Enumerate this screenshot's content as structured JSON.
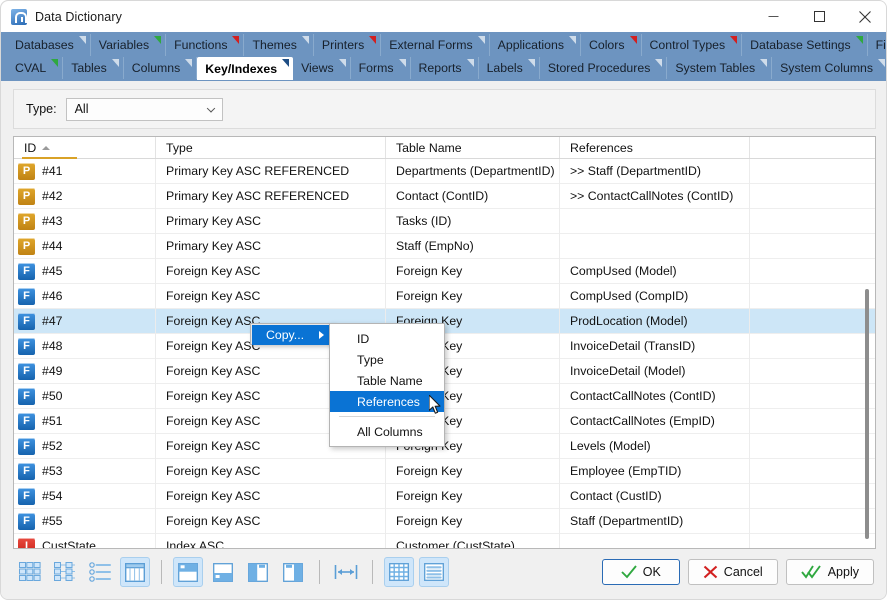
{
  "window": {
    "title": "Data Dictionary",
    "icon": "app-icon",
    "minimize_label": "–",
    "maximize_label": "□",
    "close_label": "✕"
  },
  "tabs": {
    "row1": [
      {
        "label": "Databases",
        "marker": "grey"
      },
      {
        "label": "Variables",
        "marker": "green"
      },
      {
        "label": "Functions",
        "marker": "red"
      },
      {
        "label": "Themes",
        "marker": "grey"
      },
      {
        "label": "Printers",
        "marker": "red"
      },
      {
        "label": "External Forms",
        "marker": "grey"
      },
      {
        "label": "Applications",
        "marker": "grey"
      },
      {
        "label": "Colors",
        "marker": "red"
      },
      {
        "label": "Control Types",
        "marker": "red"
      },
      {
        "label": "Database Settings",
        "marker": "green"
      },
      {
        "label": "Files",
        "marker": "grey"
      }
    ],
    "row2": [
      {
        "label": "CVAL",
        "marker": "green",
        "active": false
      },
      {
        "label": "Tables",
        "marker": "grey",
        "active": false
      },
      {
        "label": "Columns",
        "marker": "grey",
        "active": false
      },
      {
        "label": "Key/Indexes",
        "marker": "grey",
        "active": true
      },
      {
        "label": "Views",
        "marker": "grey",
        "active": false
      },
      {
        "label": "Forms",
        "marker": "grey",
        "active": false
      },
      {
        "label": "Reports",
        "marker": "grey",
        "active": false
      },
      {
        "label": "Labels",
        "marker": "grey",
        "active": false
      },
      {
        "label": "Stored Procedures",
        "marker": "grey",
        "active": false
      },
      {
        "label": "System Tables",
        "marker": "grey",
        "active": false
      },
      {
        "label": "System Columns",
        "marker": "grey",
        "active": false
      }
    ],
    "overflow_label": "▼"
  },
  "filter": {
    "label": "Type:",
    "value": "All",
    "placeholder": "All"
  },
  "grid": {
    "columns": [
      "ID",
      "Type",
      "Table Name",
      "References",
      ""
    ],
    "sort_column": "ID",
    "sort_direction": "asc",
    "rows": [
      {
        "icon": "P",
        "id": "#41",
        "type": "Primary Key ASC REFERENCED",
        "table": "Departments (DepartmentID)",
        "refs": ">> Staff (DepartmentID)",
        "selected": false
      },
      {
        "icon": "P",
        "id": "#42",
        "type": "Primary Key ASC REFERENCED",
        "table": "Contact (ContID)",
        "refs": ">> ContactCallNotes (ContID)",
        "selected": false
      },
      {
        "icon": "P",
        "id": "#43",
        "type": "Primary Key ASC",
        "table": "Tasks (ID)",
        "refs": "",
        "selected": false
      },
      {
        "icon": "P",
        "id": "#44",
        "type": "Primary Key ASC",
        "table": "Staff (EmpNo)",
        "refs": "",
        "selected": false
      },
      {
        "icon": "F",
        "id": "#45",
        "type": "Foreign Key ASC",
        "table": "Foreign Key",
        "refs": "CompUsed (Model)",
        "selected": false
      },
      {
        "icon": "F",
        "id": "#46",
        "type": "Foreign Key ASC",
        "table": "Foreign Key",
        "refs": "CompUsed (CompID)",
        "selected": false
      },
      {
        "icon": "F",
        "id": "#47",
        "type": "Foreign Key ASC",
        "table": "Foreign Key",
        "refs": "ProdLocation (Model)",
        "selected": true
      },
      {
        "icon": "F",
        "id": "#48",
        "type": "Foreign Key ASC",
        "table": "Foreign Key",
        "refs": "InvoiceDetail (TransID)",
        "selected": false
      },
      {
        "icon": "F",
        "id": "#49",
        "type": "Foreign Key ASC",
        "table": "Foreign Key",
        "refs": "InvoiceDetail (Model)",
        "selected": false
      },
      {
        "icon": "F",
        "id": "#50",
        "type": "Foreign Key ASC",
        "table": "Foreign Key",
        "refs": "ContactCallNotes (ContID)",
        "selected": false
      },
      {
        "icon": "F",
        "id": "#51",
        "type": "Foreign Key ASC",
        "table": "Foreign Key",
        "refs": "ContactCallNotes (EmpID)",
        "selected": false
      },
      {
        "icon": "F",
        "id": "#52",
        "type": "Foreign Key ASC",
        "table": "Foreign Key",
        "refs": "Levels (Model)",
        "selected": false
      },
      {
        "icon": "F",
        "id": "#53",
        "type": "Foreign Key ASC",
        "table": "Foreign Key",
        "refs": "Employee (EmpTID)",
        "selected": false
      },
      {
        "icon": "F",
        "id": "#54",
        "type": "Foreign Key ASC",
        "table": "Foreign Key",
        "refs": "Contact (CustID)",
        "selected": false
      },
      {
        "icon": "F",
        "id": "#55",
        "type": "Foreign Key ASC",
        "table": "Foreign Key",
        "refs": "Staff (DepartmentID)",
        "selected": false
      },
      {
        "icon": "I",
        "id": "CustState",
        "type": "Index ASC",
        "table": "Customer (CustState)",
        "refs": "",
        "selected": false
      }
    ]
  },
  "context_menu": {
    "parent_label": "Copy...",
    "parent_arrow": "▶",
    "items": [
      {
        "label": "ID",
        "highlighted": false
      },
      {
        "label": "Type",
        "highlighted": false
      },
      {
        "label": "Table Name",
        "highlighted": false
      },
      {
        "label": "References",
        "highlighted": true
      },
      {
        "label": "All Columns",
        "highlighted": false
      }
    ]
  },
  "toolbar": {
    "buttons": [
      {
        "name": "thumbnails-view-icon",
        "active": false
      },
      {
        "name": "tree-view-icon",
        "active": false
      },
      {
        "name": "list-view-icon",
        "active": false
      },
      {
        "name": "grid-view-icon",
        "active": true
      },
      {
        "name": "layout-top-icon",
        "active": true
      },
      {
        "name": "layout-bottom-icon",
        "active": false
      },
      {
        "name": "layout-left-icon",
        "active": false
      },
      {
        "name": "layout-right-icon",
        "active": false
      },
      {
        "name": "fit-width-icon",
        "active": false
      },
      {
        "name": "table-grid-icon",
        "active": true
      },
      {
        "name": "table-rows-icon",
        "active": true
      }
    ]
  },
  "actions": {
    "ok": "OK",
    "cancel": "Cancel",
    "apply": "Apply"
  },
  "colors": {
    "tabstrip": "#6d94c0",
    "accent": "#0a73d4",
    "selection": "#cde6f7",
    "primary_key": "#c08314",
    "foreign_key": "#1663ad",
    "index_key": "#c92016",
    "ok_check": "#2fa83f",
    "cancel_x": "#d22020"
  }
}
